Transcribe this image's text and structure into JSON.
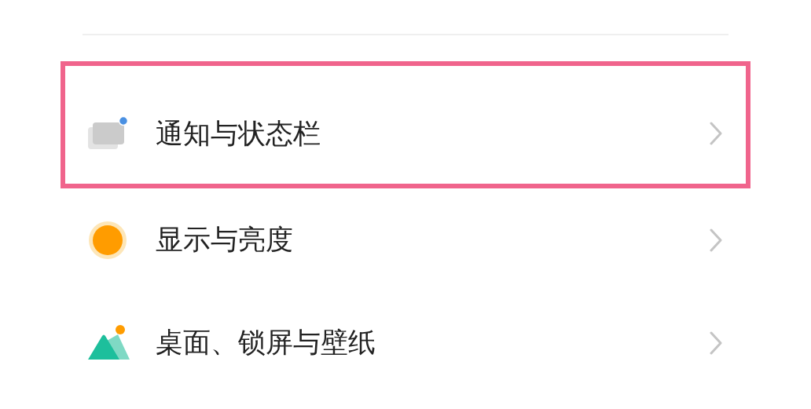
{
  "settings": [
    {
      "kind": "notification",
      "label": "通知与状态栏",
      "highlighted": true
    },
    {
      "kind": "display",
      "label": "显示与亮度",
      "highlighted": false
    },
    {
      "kind": "wallpaper",
      "label": "桌面、锁屏与壁纸",
      "highlighted": false
    }
  ]
}
